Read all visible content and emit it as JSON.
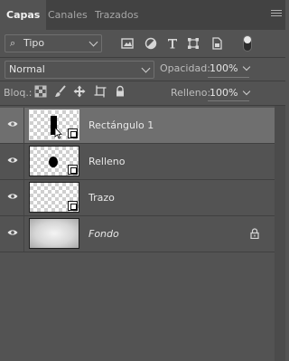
{
  "tabs": [
    {
      "label": "Capas",
      "active": true
    },
    {
      "label": "Canales",
      "active": false
    },
    {
      "label": "Trazados",
      "active": false
    }
  ],
  "filter": {
    "selected": "Tipo",
    "icons": [
      "image-filter-icon",
      "adjustment-filter-icon",
      "type-filter-icon",
      "shape-filter-icon",
      "smart-object-filter-icon"
    ]
  },
  "blend": {
    "mode": "Normal",
    "opacity_label": "Opacidad:",
    "opacity_value": "100%"
  },
  "lock": {
    "label": "Bloq.:",
    "fill_label": "Relleno:",
    "fill_value": "100%"
  },
  "layers": [
    {
      "name": "Rectángulo 1",
      "selected": true,
      "thumb": "rectangle",
      "shape": true
    },
    {
      "name": "Relleno",
      "selected": false,
      "thumb": "dot",
      "shape": true
    },
    {
      "name": "Trazo",
      "selected": false,
      "thumb": "empty",
      "shape": true
    },
    {
      "name": "Fondo",
      "selected": false,
      "thumb": "gradient",
      "locked": true
    }
  ],
  "colors": {
    "panel": "#535353",
    "tabbar": "#424242",
    "selected": "#6f6f6f"
  }
}
